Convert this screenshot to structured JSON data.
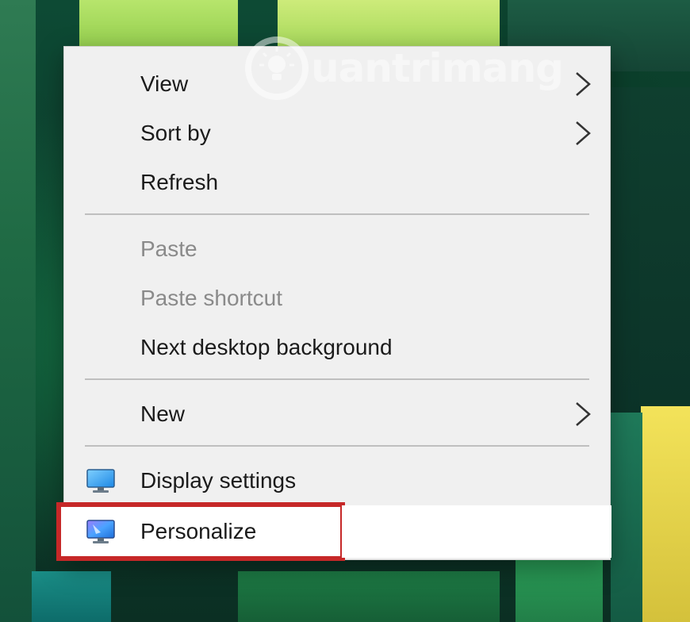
{
  "watermark": {
    "text": "uantrimang"
  },
  "context_menu": {
    "items": [
      {
        "label": "View",
        "has_submenu": true,
        "disabled": false
      },
      {
        "label": "Sort by",
        "has_submenu": true,
        "disabled": false
      },
      {
        "label": "Refresh",
        "has_submenu": false,
        "disabled": false
      },
      {
        "label": "Paste",
        "has_submenu": false,
        "disabled": true
      },
      {
        "label": "Paste shortcut",
        "has_submenu": false,
        "disabled": true
      },
      {
        "label": "Next desktop background",
        "has_submenu": false,
        "disabled": false
      },
      {
        "label": "New",
        "has_submenu": true,
        "disabled": false
      },
      {
        "label": "Display settings",
        "icon": "display-settings-icon",
        "has_submenu": false,
        "disabled": false
      },
      {
        "label": "Personalize",
        "icon": "personalize-icon",
        "has_submenu": false,
        "disabled": false,
        "highlighted": true
      }
    ]
  },
  "colors": {
    "menu_bg": "#f0f0f0",
    "highlight_border": "#c62828",
    "disabled_text": "#8a8a8a"
  }
}
